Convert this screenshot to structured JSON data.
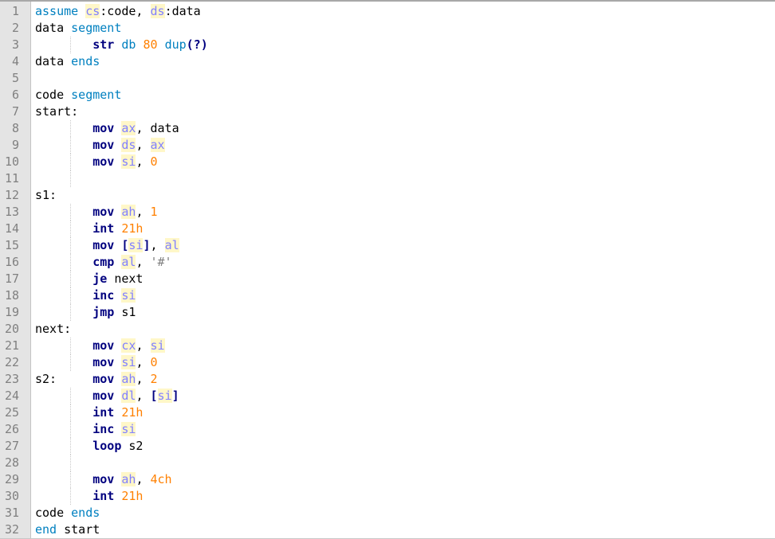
{
  "editor": {
    "colors": {
      "keyword": "#0080c0",
      "instruction": "#00007f",
      "register": "#8080ff",
      "register_bg": "#fff7c8",
      "number": "#ff8000",
      "string": "#808080",
      "gutter": "#e4e4e4"
    },
    "lines": [
      {
        "n": "1",
        "t": [
          [
            "assume",
            "kw2"
          ],
          [
            " ",
            "pl"
          ],
          [
            "cs",
            "reg"
          ],
          [
            ":code, ",
            "pl"
          ],
          [
            "ds",
            "reg"
          ],
          [
            ":data",
            "pl"
          ]
        ]
      },
      {
        "n": "2",
        "t": [
          [
            "data ",
            "pl"
          ],
          [
            "segment",
            "kw2"
          ]
        ]
      },
      {
        "n": "3",
        "guide": true,
        "t": [
          [
            "        ",
            "pl"
          ],
          [
            "str",
            "op"
          ],
          [
            " ",
            "pl"
          ],
          [
            "db",
            "kw2"
          ],
          [
            " ",
            "pl"
          ],
          [
            "80",
            "num"
          ],
          [
            " ",
            "pl"
          ],
          [
            "dup",
            "kw2"
          ],
          [
            "(?)",
            "sym"
          ]
        ]
      },
      {
        "n": "4",
        "t": [
          [
            "data ",
            "pl"
          ],
          [
            "ends",
            "kw2"
          ]
        ]
      },
      {
        "n": "5",
        "t": []
      },
      {
        "n": "6",
        "t": [
          [
            "code ",
            "pl"
          ],
          [
            "segment",
            "kw2"
          ]
        ]
      },
      {
        "n": "7",
        "t": [
          [
            "start:",
            "pl"
          ]
        ]
      },
      {
        "n": "8",
        "guide": true,
        "t": [
          [
            "        ",
            "pl"
          ],
          [
            "mov",
            "op"
          ],
          [
            " ",
            "pl"
          ],
          [
            "ax",
            "reg"
          ],
          [
            ", data",
            "pl"
          ]
        ]
      },
      {
        "n": "9",
        "guide": true,
        "t": [
          [
            "        ",
            "pl"
          ],
          [
            "mov",
            "op"
          ],
          [
            " ",
            "pl"
          ],
          [
            "ds",
            "reg"
          ],
          [
            ", ",
            "pl"
          ],
          [
            "ax",
            "reg"
          ]
        ]
      },
      {
        "n": "10",
        "guide": true,
        "t": [
          [
            "        ",
            "pl"
          ],
          [
            "mov",
            "op"
          ],
          [
            " ",
            "pl"
          ],
          [
            "si",
            "reg"
          ],
          [
            ", ",
            "pl"
          ],
          [
            "0",
            "num"
          ]
        ]
      },
      {
        "n": "11",
        "guide": true,
        "t": []
      },
      {
        "n": "12",
        "t": [
          [
            "s1:",
            "pl"
          ]
        ]
      },
      {
        "n": "13",
        "guide": true,
        "t": [
          [
            "        ",
            "pl"
          ],
          [
            "mov",
            "op"
          ],
          [
            " ",
            "pl"
          ],
          [
            "ah",
            "reg"
          ],
          [
            ", ",
            "pl"
          ],
          [
            "1",
            "num"
          ]
        ]
      },
      {
        "n": "14",
        "guide": true,
        "t": [
          [
            "        ",
            "pl"
          ],
          [
            "int",
            "op"
          ],
          [
            " ",
            "pl"
          ],
          [
            "21h",
            "num"
          ]
        ]
      },
      {
        "n": "15",
        "guide": true,
        "t": [
          [
            "        ",
            "pl"
          ],
          [
            "mov",
            "op"
          ],
          [
            " ",
            "pl"
          ],
          [
            "[",
            "sym"
          ],
          [
            "si",
            "reg"
          ],
          [
            "]",
            "sym"
          ],
          [
            ", ",
            "pl"
          ],
          [
            "al",
            "reg"
          ]
        ]
      },
      {
        "n": "16",
        "guide": true,
        "t": [
          [
            "        ",
            "pl"
          ],
          [
            "cmp",
            "op"
          ],
          [
            " ",
            "pl"
          ],
          [
            "al",
            "reg"
          ],
          [
            ", ",
            "pl"
          ],
          [
            "'#'",
            "str"
          ]
        ]
      },
      {
        "n": "17",
        "guide": true,
        "t": [
          [
            "        ",
            "pl"
          ],
          [
            "je",
            "op"
          ],
          [
            " next",
            "pl"
          ]
        ]
      },
      {
        "n": "18",
        "guide": true,
        "t": [
          [
            "        ",
            "pl"
          ],
          [
            "inc",
            "op"
          ],
          [
            " ",
            "pl"
          ],
          [
            "si",
            "reg"
          ]
        ]
      },
      {
        "n": "19",
        "guide": true,
        "t": [
          [
            "        ",
            "pl"
          ],
          [
            "jmp",
            "op"
          ],
          [
            " s1",
            "pl"
          ]
        ]
      },
      {
        "n": "20",
        "t": [
          [
            "next:",
            "pl"
          ]
        ]
      },
      {
        "n": "21",
        "guide": true,
        "t": [
          [
            "        ",
            "pl"
          ],
          [
            "mov",
            "op"
          ],
          [
            " ",
            "pl"
          ],
          [
            "cx",
            "reg"
          ],
          [
            ", ",
            "pl"
          ],
          [
            "si",
            "reg"
          ]
        ]
      },
      {
        "n": "22",
        "guide": true,
        "t": [
          [
            "        ",
            "pl"
          ],
          [
            "mov",
            "op"
          ],
          [
            " ",
            "pl"
          ],
          [
            "si",
            "reg"
          ],
          [
            ", ",
            "pl"
          ],
          [
            "0",
            "num"
          ]
        ]
      },
      {
        "n": "23",
        "t": [
          [
            "s2:     ",
            "pl"
          ],
          [
            "mov",
            "op"
          ],
          [
            " ",
            "pl"
          ],
          [
            "ah",
            "reg"
          ],
          [
            ", ",
            "pl"
          ],
          [
            "2",
            "num"
          ]
        ]
      },
      {
        "n": "24",
        "guide": true,
        "t": [
          [
            "        ",
            "pl"
          ],
          [
            "mov",
            "op"
          ],
          [
            " ",
            "pl"
          ],
          [
            "dl",
            "reg"
          ],
          [
            ", ",
            "pl"
          ],
          [
            "[",
            "sym"
          ],
          [
            "si",
            "reg"
          ],
          [
            "]",
            "sym"
          ]
        ]
      },
      {
        "n": "25",
        "guide": true,
        "t": [
          [
            "        ",
            "pl"
          ],
          [
            "int",
            "op"
          ],
          [
            " ",
            "pl"
          ],
          [
            "21h",
            "num"
          ]
        ]
      },
      {
        "n": "26",
        "guide": true,
        "t": [
          [
            "        ",
            "pl"
          ],
          [
            "inc",
            "op"
          ],
          [
            " ",
            "pl"
          ],
          [
            "si",
            "reg"
          ]
        ]
      },
      {
        "n": "27",
        "guide": true,
        "t": [
          [
            "        ",
            "pl"
          ],
          [
            "loop",
            "op"
          ],
          [
            " s2",
            "pl"
          ]
        ]
      },
      {
        "n": "28",
        "guide": true,
        "t": []
      },
      {
        "n": "29",
        "guide": true,
        "t": [
          [
            "        ",
            "pl"
          ],
          [
            "mov",
            "op"
          ],
          [
            " ",
            "pl"
          ],
          [
            "ah",
            "reg"
          ],
          [
            ", ",
            "pl"
          ],
          [
            "4ch",
            "num"
          ]
        ]
      },
      {
        "n": "30",
        "guide": true,
        "t": [
          [
            "        ",
            "pl"
          ],
          [
            "int",
            "op"
          ],
          [
            " ",
            "pl"
          ],
          [
            "21h",
            "num"
          ]
        ]
      },
      {
        "n": "31",
        "t": [
          [
            "code ",
            "pl"
          ],
          [
            "ends",
            "kw2"
          ]
        ]
      },
      {
        "n": "32",
        "t": [
          [
            "end",
            "kw2"
          ],
          [
            " start",
            "pl"
          ]
        ]
      }
    ]
  }
}
